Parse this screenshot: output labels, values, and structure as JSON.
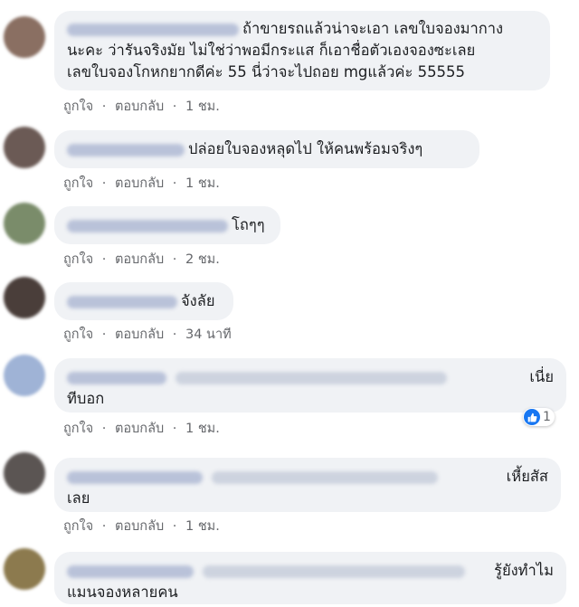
{
  "comments": [
    {
      "avatar_color": "#8a6f62",
      "lines": [
        "ถ้าขายรถแล้วน่าจะเอา เลขใบจองมากาง",
        "นะคะ ว่ารันจริงมัย ไม่ใช่ว่าพอมีกระแส ก็เอาชื่อตัวเองจองซะเลย",
        "เลขใบจองโกหกยากดีค่ะ 55 นี่ว่าจะไปถอย mgแล้วค่ะ 55555"
      ],
      "like": "ถูกใจ",
      "reply": "ตอบกลับ",
      "time": "1 ชม."
    },
    {
      "avatar_color": "#6b5a55",
      "lines": [
        "ปล่อยใบจองหลุดไป ให้คนพร้อมจริงๆ"
      ],
      "like": "ถูกใจ",
      "reply": "ตอบกลับ",
      "time": "1 ชม."
    },
    {
      "avatar_color": "#7a8c6a",
      "lines": [
        "โถๆๆ"
      ],
      "like": "ถูกใจ",
      "reply": "ตอบกลับ",
      "time": "2 ชม."
    },
    {
      "avatar_color": "#4a3e3a",
      "lines": [
        "จังลัย"
      ],
      "like": "ถูกใจ",
      "reply": "ตอบกลับ",
      "time": "34 นาที"
    },
    {
      "avatar_color": "#9fb3d6",
      "lines": [
        "เนี่ย",
        "ทีบอก"
      ],
      "like": "ถูกใจ",
      "reply": "ตอบกลับ",
      "time": "1 ชม.",
      "reaction_count": "1"
    },
    {
      "avatar_color": "#5b5553",
      "lines": [
        "เหี้ยสัส",
        "เลย"
      ],
      "like": "ถูกใจ",
      "reply": "ตอบกลับ",
      "time": "1 ชม."
    },
    {
      "avatar_color": "#8c7a4e",
      "lines": [
        "รู้ยังทำไม",
        "แมนจองหลายคน"
      ]
    }
  ],
  "separator": "·"
}
